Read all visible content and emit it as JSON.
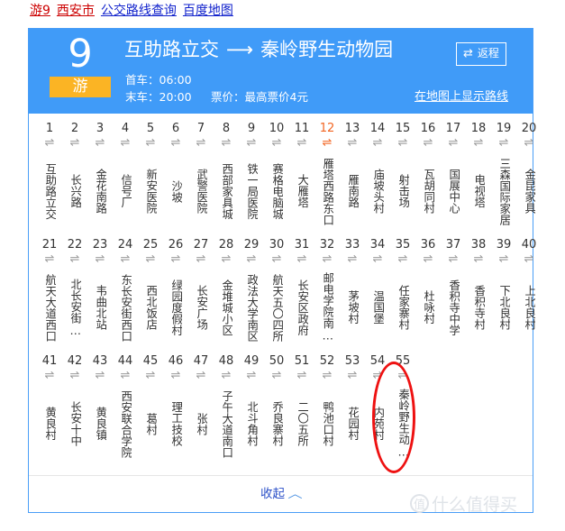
{
  "breadcrumb": {
    "items": [
      {
        "text": "游9",
        "state": "visited"
      },
      {
        "text": "西安市",
        "state": "visited"
      },
      {
        "text": "公交路线查询",
        "state": "link"
      },
      {
        "text": "百度地图",
        "state": "link"
      }
    ]
  },
  "header": {
    "line_number": "9",
    "line_tag": "游",
    "origin": "互助路立交",
    "arrow": "⟶",
    "destination": "秦岭野生动物园",
    "return_button": {
      "icon": "⇄",
      "label": "返程"
    },
    "first_bus": "首车：06:00",
    "last_bus": "末车：20:00",
    "fare": "票价：最高票价4元",
    "map_link": "在地图上显示路线",
    "colors": {
      "header_bg": "#409bf8",
      "tag_bg": "#fbb424",
      "border": "#4a9ef7"
    }
  },
  "stations": {
    "icon": "⇌",
    "highlight_color": "#f26522",
    "rows": [
      [
        {
          "num": "1",
          "name": "互助路立交",
          "highlight": false
        },
        {
          "num": "2",
          "name": "长兴路",
          "highlight": false
        },
        {
          "num": "3",
          "name": "金花南路",
          "highlight": false
        },
        {
          "num": "4",
          "name": "信号厂",
          "highlight": false
        },
        {
          "num": "5",
          "name": "新安医院",
          "highlight": false
        },
        {
          "num": "6",
          "name": "沙坡",
          "highlight": false
        },
        {
          "num": "7",
          "name": "武警医院",
          "highlight": false
        },
        {
          "num": "8",
          "name": "西部家具城",
          "highlight": false
        },
        {
          "num": "9",
          "name": "铁一局医院",
          "highlight": false
        },
        {
          "num": "10",
          "name": "赛格电脑城",
          "highlight": false
        },
        {
          "num": "11",
          "name": "大雁塔",
          "highlight": false
        },
        {
          "num": "12",
          "name": "雁塔西路东口",
          "highlight": true
        },
        {
          "num": "13",
          "name": "雁南路",
          "highlight": false
        },
        {
          "num": "14",
          "name": "庙坡头村",
          "highlight": false
        },
        {
          "num": "15",
          "name": "射击场",
          "highlight": false
        },
        {
          "num": "16",
          "name": "瓦胡同村",
          "highlight": false
        },
        {
          "num": "17",
          "name": "国展中心",
          "highlight": false
        },
        {
          "num": "18",
          "name": "电视塔",
          "highlight": false
        },
        {
          "num": "19",
          "name": "三森国际家居",
          "highlight": false
        },
        {
          "num": "20",
          "name": "金昆家具",
          "highlight": false
        }
      ],
      [
        {
          "num": "21",
          "name": "航天大道西口",
          "highlight": false
        },
        {
          "num": "22",
          "name": "北长安街…",
          "highlight": false
        },
        {
          "num": "23",
          "name": "韦曲北站",
          "highlight": false
        },
        {
          "num": "24",
          "name": "东长安街西口",
          "highlight": false
        },
        {
          "num": "25",
          "name": "西北饭店",
          "highlight": false
        },
        {
          "num": "26",
          "name": "绿园度假村",
          "highlight": false
        },
        {
          "num": "27",
          "name": "长安广场",
          "highlight": false
        },
        {
          "num": "28",
          "name": "金堆城小区",
          "highlight": false
        },
        {
          "num": "29",
          "name": "政法大学南区",
          "highlight": false
        },
        {
          "num": "30",
          "name": "航天五〇四所",
          "highlight": false
        },
        {
          "num": "31",
          "name": "长安区政府",
          "highlight": false
        },
        {
          "num": "32",
          "name": "邮电学院南…",
          "highlight": false
        },
        {
          "num": "33",
          "name": "茅坡村",
          "highlight": false
        },
        {
          "num": "34",
          "name": "温国堡",
          "highlight": false
        },
        {
          "num": "35",
          "name": "任家寨村",
          "highlight": false
        },
        {
          "num": "36",
          "name": "杜咏村",
          "highlight": false
        },
        {
          "num": "37",
          "name": "香积寺中学",
          "highlight": false
        },
        {
          "num": "38",
          "name": "香积寺村",
          "highlight": false
        },
        {
          "num": "39",
          "name": "下北良村",
          "highlight": false
        },
        {
          "num": "40",
          "name": "上北良村",
          "highlight": false
        }
      ],
      [
        {
          "num": "41",
          "name": "黄良村",
          "highlight": false
        },
        {
          "num": "42",
          "name": "长安十中",
          "highlight": false
        },
        {
          "num": "43",
          "name": "黄良镇",
          "highlight": false
        },
        {
          "num": "44",
          "name": "西安联合学院",
          "highlight": false
        },
        {
          "num": "45",
          "name": "葛村",
          "highlight": false
        },
        {
          "num": "46",
          "name": "理工技校",
          "highlight": false
        },
        {
          "num": "47",
          "name": "张村",
          "highlight": false
        },
        {
          "num": "48",
          "name": "子午大道南口",
          "highlight": false
        },
        {
          "num": "49",
          "name": "北斗角村",
          "highlight": false
        },
        {
          "num": "50",
          "name": "乔良寨村",
          "highlight": false
        },
        {
          "num": "51",
          "name": "二〇五所",
          "highlight": false
        },
        {
          "num": "52",
          "name": "鸭池口村",
          "highlight": false
        },
        {
          "num": "53",
          "name": "花园村",
          "highlight": false
        },
        {
          "num": "54",
          "name": "内苑村",
          "highlight": false
        },
        {
          "num": "55",
          "name": "秦岭野生动…",
          "highlight": false
        }
      ]
    ]
  },
  "footer": {
    "collapse_label": "收起",
    "collapse_icon": "︿"
  },
  "watermark": {
    "mark": "值",
    "text": "什么值得买"
  }
}
